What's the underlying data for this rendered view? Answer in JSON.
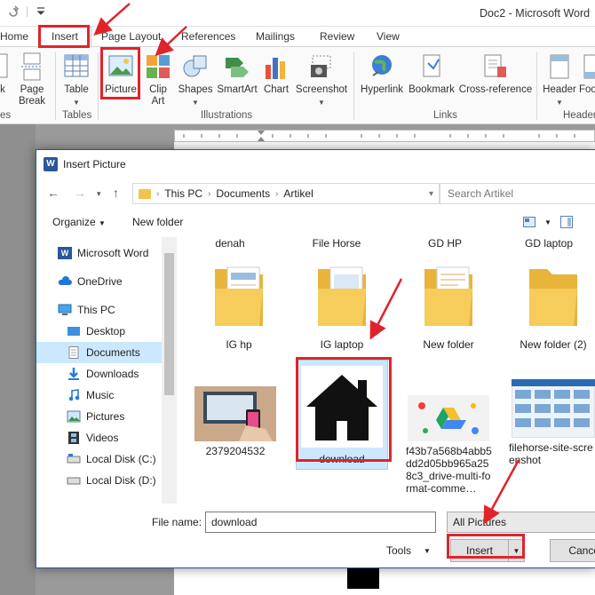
{
  "window": {
    "title": "Doc2 - Microsoft Word"
  },
  "ribbon_tabs": [
    "Home",
    "Insert",
    "Page Layout",
    "References",
    "Mailings",
    "Review",
    "View"
  ],
  "ribbon": {
    "page_break": "Page Break",
    "pages_label": "k",
    "pages_group": "es",
    "table": "Table",
    "tables_group": "Tables",
    "picture": "Picture",
    "clip_art": "Clip Art",
    "shapes": "Shapes",
    "smartart": "SmartArt",
    "chart": "Chart",
    "screenshot": "Screenshot",
    "illustrations_group": "Illustrations",
    "hyperlink": "Hyperlink",
    "bookmark": "Bookmark",
    "cross_reference": "Cross-reference",
    "links_group": "Links",
    "header": "Header",
    "footer_partial": "Foo",
    "header_group_partial": "Header"
  },
  "dialog": {
    "title": "Insert Picture",
    "breadcrumb": [
      "This PC",
      "Documents",
      "Artikel"
    ],
    "search_placeholder": "Search Artikel",
    "organize": "Organize",
    "new_folder": "New folder",
    "sidebar": [
      {
        "label": "Microsoft Word",
        "icon": "word-icon"
      },
      {
        "label": "OneDrive",
        "icon": "cloud-icon"
      },
      {
        "label": "This PC",
        "icon": "computer-icon"
      },
      {
        "label": "Desktop",
        "icon": "desktop-icon"
      },
      {
        "label": "Documents",
        "icon": "documents-icon",
        "selected": true
      },
      {
        "label": "Downloads",
        "icon": "download-arrow-icon"
      },
      {
        "label": "Music",
        "icon": "music-note-icon"
      },
      {
        "label": "Pictures",
        "icon": "pictures-icon"
      },
      {
        "label": "Videos",
        "icon": "film-icon"
      },
      {
        "label": "Local Disk (C:)",
        "icon": "disk-icon"
      },
      {
        "label": "Local Disk (D:)",
        "icon": "disk-icon"
      }
    ],
    "top_row_names": [
      "denah",
      "File Horse",
      "GD HP",
      "GD laptop"
    ],
    "folders": [
      "IG hp",
      "IG laptop",
      "New folder",
      "New folder (2)"
    ],
    "images": [
      {
        "name": "2379204532"
      },
      {
        "name": "download",
        "selected": true
      },
      {
        "name": "f43b7a568b4abb5dd2d05bb965a258c3_drive-multi-format-comme…"
      },
      {
        "name": "filehorse-site-screenshot"
      }
    ],
    "file_name_label": "File name:",
    "file_name_value": "download",
    "filter": "All Pictures",
    "tools": "Tools",
    "insert": "Insert",
    "cancel": "Cancel"
  },
  "colors": {
    "annotation_red": "#e0232b",
    "selection_blue": "#cce8ff",
    "word_blue": "#2b579a"
  }
}
